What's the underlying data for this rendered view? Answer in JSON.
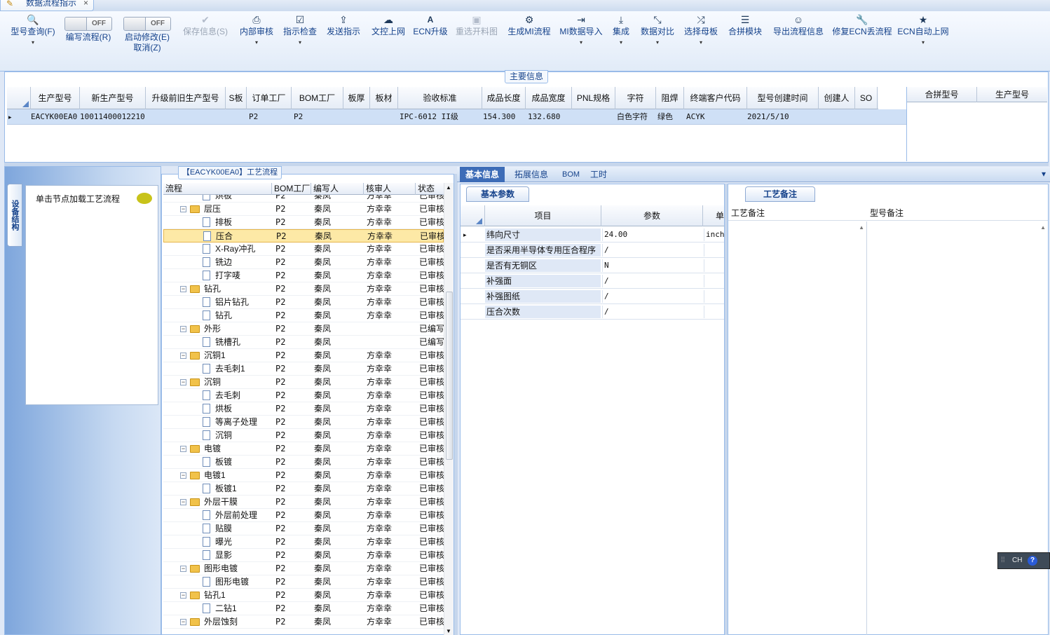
{
  "window": {
    "tab_label": "数据流程指示",
    "close_glyph": "×"
  },
  "toolbar": {
    "model_query": {
      "icon": "search-icon",
      "label": "型号查询(F)"
    },
    "write_flow": {
      "toggle": "OFF",
      "label": "编写流程(R)"
    },
    "start_modify": {
      "toggle": "OFF",
      "label": "启动修改(E)",
      "sub_label": "取消(Z)"
    },
    "save_info": {
      "icon": "check-icon",
      "label": "保存信息(S)"
    },
    "internal_review": {
      "icon": "printer-icon",
      "label": "内部审核"
    },
    "instruction_check": {
      "icon": "check-icon",
      "label": "指示检查"
    },
    "send_instruction": {
      "icon": "upload-icon",
      "label": "发送指示"
    },
    "text_upload": {
      "icon": "cloud-icon",
      "label": "文控上网"
    },
    "ecn_upgrade": {
      "icon": "font-icon",
      "label": "ECN升级"
    },
    "reselect_drawing": {
      "icon": "image-icon",
      "label": "重选开料图"
    },
    "gen_mi_flow": {
      "icon": "cog-icon",
      "label": "生成MI流程"
    },
    "mi_import": {
      "icon": "import-icon",
      "label": "MI数据导入"
    },
    "integrate": {
      "icon": "download-icon",
      "label": "集成"
    },
    "data_compare": {
      "icon": "compress-icon",
      "label": "数据对比"
    },
    "choose_mother": {
      "icon": "shuffle-icon",
      "label": "选择母板"
    },
    "merge_module": {
      "icon": "list-icon",
      "label": "合拼模块"
    },
    "export_flow": {
      "icon": "smile-icon",
      "label": "导出流程信息"
    },
    "repair_ecn": {
      "icon": "wrench-icon",
      "label": "修复ECN丢流程"
    },
    "ecn_auto": {
      "icon": "star-icon",
      "label": "ECN自动上网"
    },
    "dropdown_glyph": "▾"
  },
  "main_info": {
    "title": "主要信息",
    "columns": [
      "生产型号",
      "新生产型号",
      "升级前旧生产型号",
      "S板",
      "订单工厂",
      "BOM工厂",
      "板厚",
      "板材",
      "验收标准",
      "成品长度",
      "成品宽度",
      "PNL规格",
      "字符",
      "阻焊",
      "终端客户代码",
      "型号创建时间",
      "创建人",
      "SO"
    ],
    "row": {
      "生产型号": "EACYK00EA0",
      "新生产型号": "10011400012210",
      "S板": "P2",
      "订单工厂": "P2",
      "验收标准": "IPC-6012 II级",
      "成品长度": "154.300",
      "成品宽度": "132.680",
      "字符": "白色字符",
      "阻焊": "绿色",
      "终端客户代码": "ACYK",
      "型号创建时间": "2021/5/10"
    },
    "row_marker": "▸",
    "side_columns": [
      "合拼型号",
      "生产型号"
    ]
  },
  "left_panel": {
    "vertical_tab": "设备结构",
    "node_hint": "单击节点加载工艺流程"
  },
  "process": {
    "title": "【EACYK00EA0】工艺流程",
    "columns": [
      "流程",
      "BOM工厂",
      "编写人",
      "核审人",
      "状态"
    ],
    "rows": [
      {
        "level": 2,
        "type": "doc",
        "name": "烘板",
        "bom": "P2",
        "writer": "秦凤",
        "reviewer": "方幸幸",
        "status": "已审核"
      },
      {
        "level": 1,
        "type": "folder",
        "name": "层压",
        "bom": "P2",
        "writer": "秦凤",
        "reviewer": "方幸幸",
        "status": "已审核"
      },
      {
        "level": 2,
        "type": "doc",
        "name": "排板",
        "bom": "P2",
        "writer": "秦凤",
        "reviewer": "方幸幸",
        "status": "已审核"
      },
      {
        "level": 2,
        "type": "doc",
        "name": "压合",
        "bom": "P2",
        "writer": "秦凤",
        "reviewer": "方幸幸",
        "status": "已审核",
        "selected": true
      },
      {
        "level": 2,
        "type": "doc",
        "name": "X-Ray冲孔",
        "bom": "P2",
        "writer": "秦凤",
        "reviewer": "方幸幸",
        "status": "已审核"
      },
      {
        "level": 2,
        "type": "doc",
        "name": "铣边",
        "bom": "P2",
        "writer": "秦凤",
        "reviewer": "方幸幸",
        "status": "已审核"
      },
      {
        "level": 2,
        "type": "doc",
        "name": "打字唛",
        "bom": "P2",
        "writer": "秦凤",
        "reviewer": "方幸幸",
        "status": "已审核"
      },
      {
        "level": 1,
        "type": "folder",
        "name": "钻孔",
        "bom": "P2",
        "writer": "秦凤",
        "reviewer": "方幸幸",
        "status": "已审核"
      },
      {
        "level": 2,
        "type": "doc",
        "name": "铝片钻孔",
        "bom": "P2",
        "writer": "秦凤",
        "reviewer": "方幸幸",
        "status": "已审核"
      },
      {
        "level": 2,
        "type": "doc",
        "name": "钻孔",
        "bom": "P2",
        "writer": "秦凤",
        "reviewer": "方幸幸",
        "status": "已审核"
      },
      {
        "level": 1,
        "type": "folder",
        "name": "外形",
        "bom": "P2",
        "writer": "秦凤",
        "reviewer": "",
        "status": "已编写"
      },
      {
        "level": 2,
        "type": "doc",
        "name": "铣槽孔",
        "bom": "P2",
        "writer": "秦凤",
        "reviewer": "",
        "status": "已编写"
      },
      {
        "level": 1,
        "type": "folder",
        "name": "沉铜1",
        "bom": "P2",
        "writer": "秦凤",
        "reviewer": "方幸幸",
        "status": "已审核"
      },
      {
        "level": 2,
        "type": "doc",
        "name": "去毛刺1",
        "bom": "P2",
        "writer": "秦凤",
        "reviewer": "方幸幸",
        "status": "已审核"
      },
      {
        "level": 1,
        "type": "folder",
        "name": "沉铜",
        "bom": "P2",
        "writer": "秦凤",
        "reviewer": "方幸幸",
        "status": "已审核"
      },
      {
        "level": 2,
        "type": "doc",
        "name": "去毛刺",
        "bom": "P2",
        "writer": "秦凤",
        "reviewer": "方幸幸",
        "status": "已审核"
      },
      {
        "level": 2,
        "type": "doc",
        "name": "烘板",
        "bom": "P2",
        "writer": "秦凤",
        "reviewer": "方幸幸",
        "status": "已审核"
      },
      {
        "level": 2,
        "type": "doc",
        "name": "等离子处理",
        "bom": "P2",
        "writer": "秦凤",
        "reviewer": "方幸幸",
        "status": "已审核"
      },
      {
        "level": 2,
        "type": "doc",
        "name": "沉铜",
        "bom": "P2",
        "writer": "秦凤",
        "reviewer": "方幸幸",
        "status": "已审核"
      },
      {
        "level": 1,
        "type": "folder",
        "name": "电镀",
        "bom": "P2",
        "writer": "秦凤",
        "reviewer": "方幸幸",
        "status": "已审核"
      },
      {
        "level": 2,
        "type": "doc",
        "name": "板镀",
        "bom": "P2",
        "writer": "秦凤",
        "reviewer": "方幸幸",
        "status": "已审核"
      },
      {
        "level": 1,
        "type": "folder",
        "name": "电镀1",
        "bom": "P2",
        "writer": "秦凤",
        "reviewer": "方幸幸",
        "status": "已审核"
      },
      {
        "level": 2,
        "type": "doc",
        "name": "板镀1",
        "bom": "P2",
        "writer": "秦凤",
        "reviewer": "方幸幸",
        "status": "已审核"
      },
      {
        "level": 1,
        "type": "folder",
        "name": "外层干膜",
        "bom": "P2",
        "writer": "秦凤",
        "reviewer": "方幸幸",
        "status": "已审核"
      },
      {
        "level": 2,
        "type": "doc",
        "name": "外层前处理",
        "bom": "P2",
        "writer": "秦凤",
        "reviewer": "方幸幸",
        "status": "已审核"
      },
      {
        "level": 2,
        "type": "doc",
        "name": "贴膜",
        "bom": "P2",
        "writer": "秦凤",
        "reviewer": "方幸幸",
        "status": "已审核"
      },
      {
        "level": 2,
        "type": "doc",
        "name": "曝光",
        "bom": "P2",
        "writer": "秦凤",
        "reviewer": "方幸幸",
        "status": "已审核"
      },
      {
        "level": 2,
        "type": "doc",
        "name": "显影",
        "bom": "P2",
        "writer": "秦凤",
        "reviewer": "方幸幸",
        "status": "已审核"
      },
      {
        "level": 1,
        "type": "folder",
        "name": "图形电镀",
        "bom": "P2",
        "writer": "秦凤",
        "reviewer": "方幸幸",
        "status": "已审核"
      },
      {
        "level": 2,
        "type": "doc",
        "name": "图形电镀",
        "bom": "P2",
        "writer": "秦凤",
        "reviewer": "方幸幸",
        "status": "已审核"
      },
      {
        "level": 1,
        "type": "folder",
        "name": "钻孔1",
        "bom": "P2",
        "writer": "秦凤",
        "reviewer": "方幸幸",
        "status": "已审核"
      },
      {
        "level": 2,
        "type": "doc",
        "name": "二钻1",
        "bom": "P2",
        "writer": "秦凤",
        "reviewer": "方幸幸",
        "status": "已审核"
      },
      {
        "level": 1,
        "type": "folder",
        "name": "外层蚀刻",
        "bom": "P2",
        "writer": "秦凤",
        "reviewer": "方幸幸",
        "status": "已审核"
      }
    ]
  },
  "right_tabs": [
    "基本信息",
    "拓展信息",
    "BOM",
    "工时"
  ],
  "basic_params": {
    "title": "基本参数",
    "columns": [
      "项目",
      "参数",
      "单"
    ],
    "rows": [
      {
        "name": "纬向尺寸",
        "value": "24.00",
        "unit": "inch"
      },
      {
        "name": "是否采用半导体专用压合程序",
        "value": "/",
        "unit": ""
      },
      {
        "name": "是否有无铜区",
        "value": "N",
        "unit": ""
      },
      {
        "name": "补强面",
        "value": "/",
        "unit": ""
      },
      {
        "name": "补强图纸",
        "value": "/",
        "unit": ""
      },
      {
        "name": "压合次数",
        "value": "/",
        "unit": ""
      }
    ]
  },
  "remarks": {
    "title": "工艺备注",
    "process_remark": "工艺备注",
    "model_remark": "型号备注"
  },
  "lang_bar": {
    "lang": "CH",
    "help": "?"
  }
}
